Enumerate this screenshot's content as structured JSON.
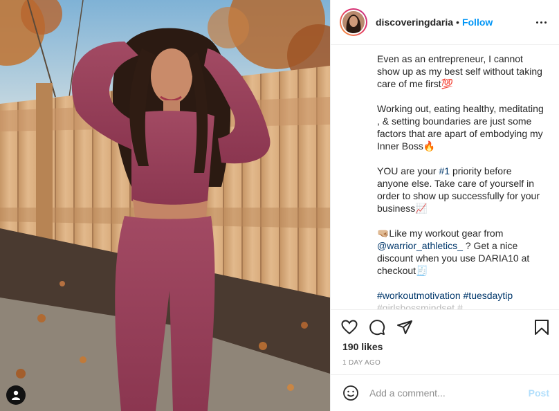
{
  "post": {
    "username": "discoveringdaria",
    "separator": "•",
    "follow_label": "Follow",
    "caption": {
      "p1": "Even as an entrepreneur, I cannot show up as my best self without taking care of me first💯",
      "p2": "Working out, eating healthy, meditating , & setting boundaries are just some factors that are apart of embodying my Inner Boss🔥",
      "p3_a": "YOU are your ",
      "p3_link": "#1",
      "p3_b": " priority before anyone else. Take care of yourself in order to show up successfully for your business📈",
      "p4_a": "🤜🏼Like my workout gear from ",
      "p4_link": "@warrior_athletics_",
      "p4_b": " ? Get a nice discount when you use DARIA10 at checkout🧾",
      "tag1": "#workoutmotivation",
      "tag2": "#tuesdaytip",
      "tag3": "#girlsbossmindset #..."
    },
    "likes": "190 likes",
    "time": "1 DAY AGO"
  },
  "comment": {
    "placeholder": "Add a comment...",
    "post_label": "Post"
  },
  "colors": {
    "accent": "#0095f6",
    "post_disabled": "#b2dffc",
    "text": "#262626",
    "muted": "#8e8e8e"
  },
  "icons": [
    "heart-icon",
    "comment-icon",
    "share-icon",
    "bookmark-icon",
    "emoji-icon",
    "more-icon",
    "user-tag-icon"
  ]
}
